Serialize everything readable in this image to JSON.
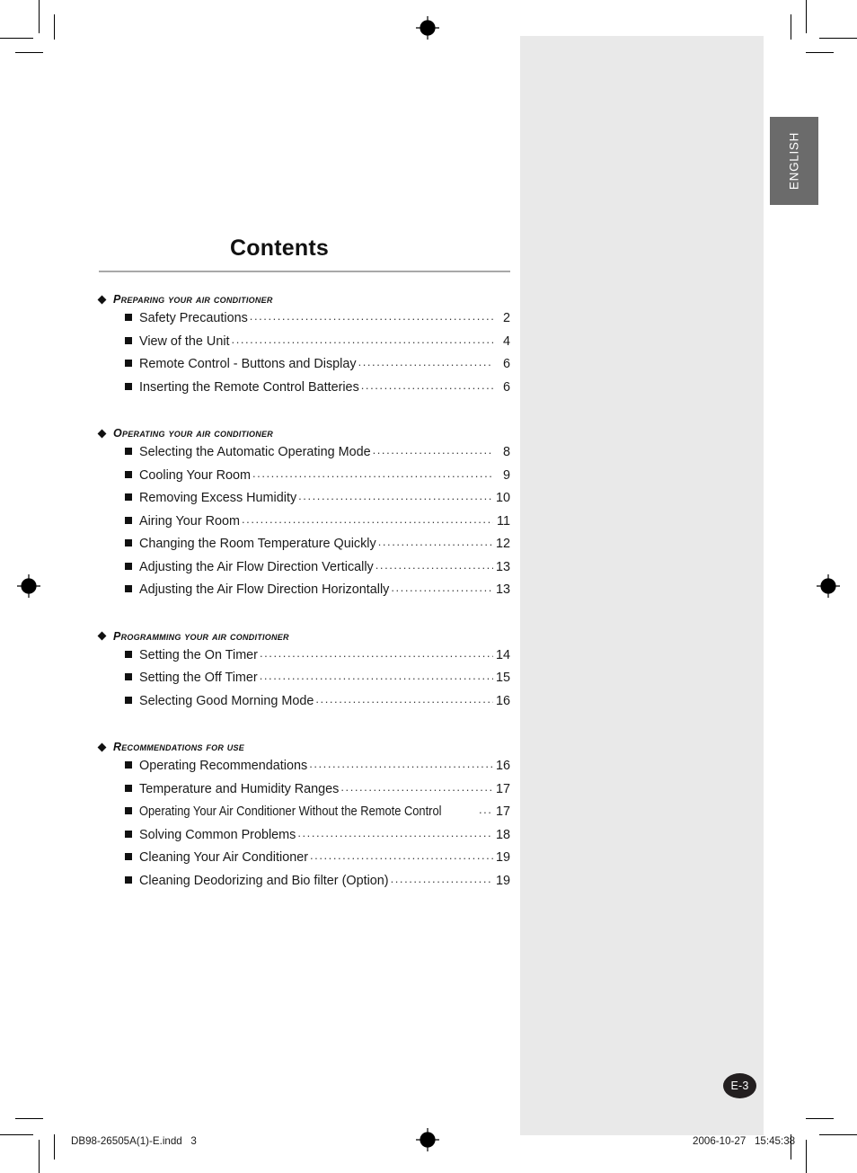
{
  "document": {
    "title": "Contents",
    "language_tab": "ENGLISH",
    "page_badge": "E-3"
  },
  "sections": [
    {
      "heading": "Preparing your air conditioner",
      "items": [
        {
          "label": "Safety Precautions",
          "page": "2"
        },
        {
          "label": "View of the Unit",
          "page": "4"
        },
        {
          "label": "Remote Control - Buttons and Display",
          "page": "6"
        },
        {
          "label": "Inserting the Remote Control Batteries",
          "page": "6"
        }
      ]
    },
    {
      "heading": "Operating your air conditioner",
      "items": [
        {
          "label": "Selecting the Automatic Operating Mode",
          "page": "8"
        },
        {
          "label": "Cooling Your Room",
          "page": "9"
        },
        {
          "label": "Removing Excess Humidity",
          "page": "10"
        },
        {
          "label": "Airing Your Room",
          "page": "11"
        },
        {
          "label": "Changing the Room Temperature Quickly",
          "page": "12"
        },
        {
          "label": "Adjusting the Air Flow Direction Vertically",
          "page": "13"
        },
        {
          "label": "Adjusting the Air Flow Direction Horizontally",
          "page": "13"
        }
      ]
    },
    {
      "heading": "Programming your air conditioner",
      "items": [
        {
          "label": "Setting the On Timer",
          "page": "14"
        },
        {
          "label": "Setting the Off Timer",
          "page": "15"
        },
        {
          "label": "Selecting Good Morning Mode",
          "page": "16"
        }
      ]
    },
    {
      "heading": "Recommendations for use",
      "items": [
        {
          "label": "Operating Recommendations",
          "page": "16"
        },
        {
          "label": "Temperature and Humidity Ranges",
          "page": "17"
        },
        {
          "label": "Operating Your Air Conditioner Without the Remote Control",
          "page": "17",
          "condensed": true
        },
        {
          "label": "Solving Common Problems",
          "page": "18"
        },
        {
          "label": "Cleaning Your Air Conditioner",
          "page": "19"
        },
        {
          "label": "Cleaning Deodorizing and Bio filter (Option)",
          "page": "19"
        }
      ]
    }
  ],
  "footer": {
    "file_name": "DB98-26505A(1)-E.indd   3",
    "timestamp": "2006-10-27   15:45:38"
  },
  "leader_dots": "......................................................................................................."
}
